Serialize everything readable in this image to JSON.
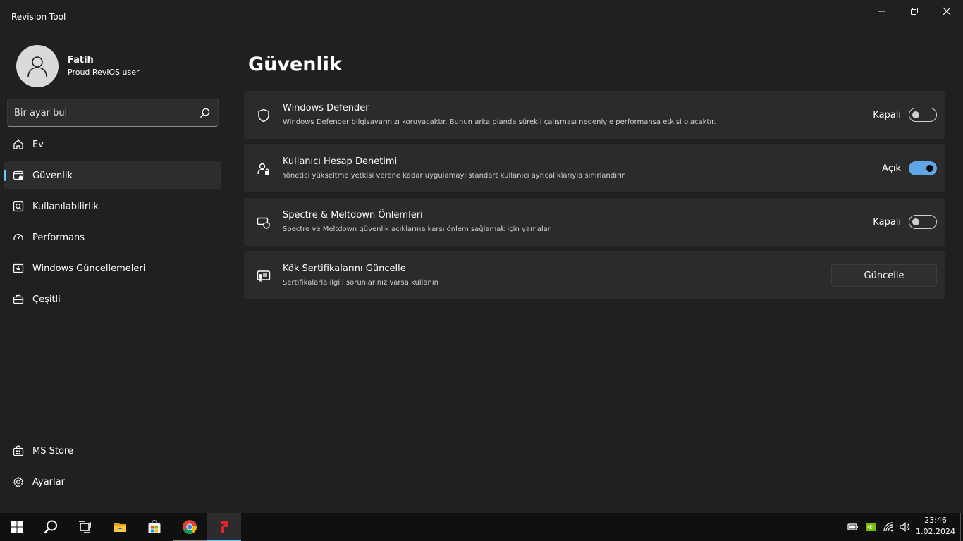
{
  "window": {
    "title": "Revision Tool"
  },
  "profile": {
    "name": "Fatih",
    "subtitle": "Proud ReviOS user"
  },
  "search": {
    "placeholder": "Bir ayar bul"
  },
  "sidebar": {
    "items": [
      {
        "label": "Ev",
        "icon": "home-icon"
      },
      {
        "label": "Güvenlik",
        "icon": "security-icon",
        "active": true
      },
      {
        "label": "Kullanılabilirlik",
        "icon": "usability-icon"
      },
      {
        "label": "Performans",
        "icon": "gauge-icon"
      },
      {
        "label": "Windows Güncellemeleri",
        "icon": "update-icon"
      },
      {
        "label": "Çeşitli",
        "icon": "toolbox-icon"
      }
    ],
    "bottom": [
      {
        "label": "MS Store",
        "icon": "store-icon"
      },
      {
        "label": "Ayarlar",
        "icon": "gear-icon"
      }
    ]
  },
  "page": {
    "title": "Güvenlik"
  },
  "cards": [
    {
      "title": "Windows Defender",
      "description": "Windows Defender bilgisayarınızı koruyacaktır. Bunun arka planda sürekli çalışması nedeniyle performansa etkisi olacaktır.",
      "state_label": "Kapalı",
      "on": false
    },
    {
      "title": "Kullanıcı Hesap Denetimi",
      "description": "Yönetici yükseltme yetkisi verene kadar uygulamayı standart kullanıcı ayrıcalıklarıyla sınırlandırır",
      "state_label": "Açık",
      "on": true
    },
    {
      "title": "Spectre & Meltdown Önlemleri",
      "description": "Spectre ve Meltdown güvenlik açıklarına karşı önlem sağlamak için yamalar",
      "state_label": "Kapalı",
      "on": false
    },
    {
      "title": "Kök Sertifikalarını Güncelle",
      "description": "Sertifikalarla ilgili sorunlarınız varsa kullanın",
      "button_label": "Güncelle"
    }
  ],
  "taskbar": {
    "apps": [
      "windows-start-icon",
      "search-icon",
      "task-view-icon",
      "file-explorer-icon",
      "ms-store-icon",
      "chrome-icon",
      "revision-tool-icon"
    ],
    "clock": {
      "time": "23:46",
      "date": "1.02.2024"
    }
  },
  "colors": {
    "accent": "#60cdff",
    "toggle_on": "#60a5e5",
    "background": "#202020",
    "card": "#2b2b2b"
  }
}
